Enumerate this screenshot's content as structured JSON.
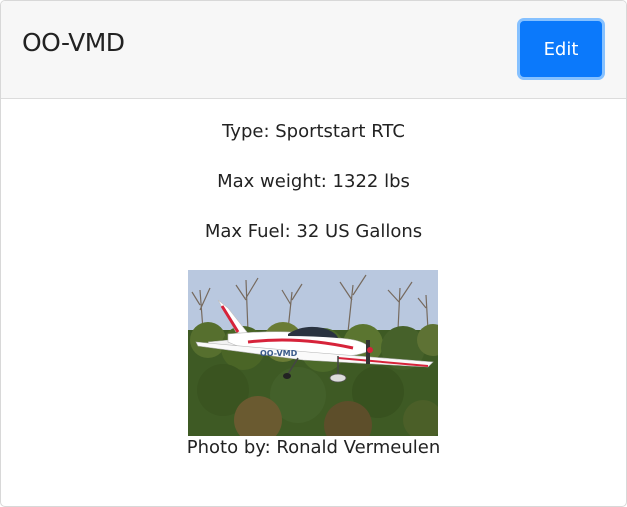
{
  "header": {
    "registration": "OO-VMD",
    "edit_label": "Edit"
  },
  "details": {
    "type_text": "Type: Sportstart RTC",
    "max_weight_text": "Max weight: 1322 lbs",
    "max_fuel_text": "Max Fuel: 32 US Gallons"
  },
  "photo": {
    "aircraft_marking": "OO-VMD",
    "credit_text": "Photo by: Ronald Vermeulen"
  },
  "colors": {
    "primary_button": "#0b79fb",
    "header_bg": "#f7f7f7"
  }
}
